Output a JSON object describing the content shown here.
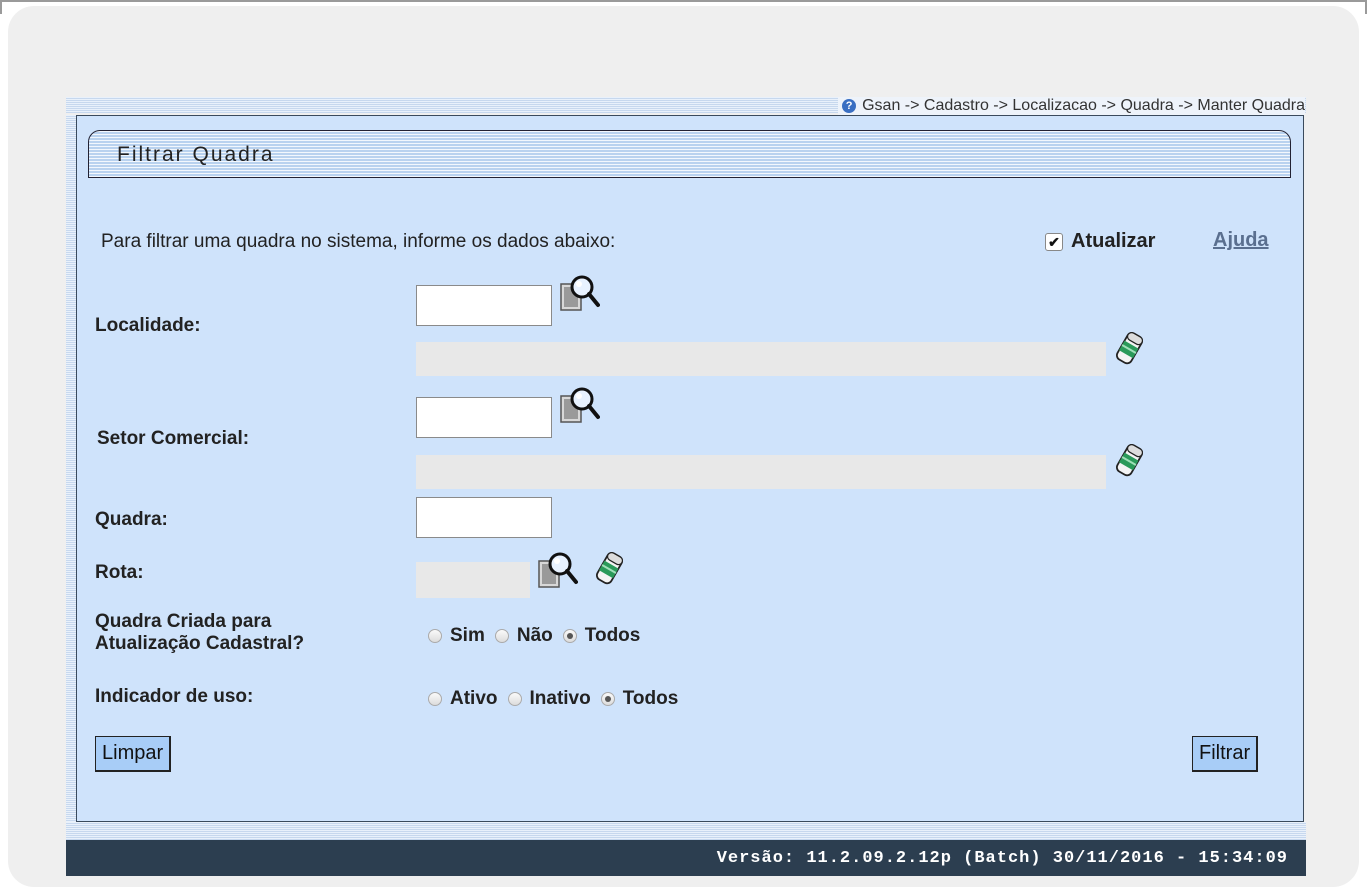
{
  "breadcrumb": "Gsan -> Cadastro -> Localizacao -> Quadra -> Manter Quadra",
  "form": {
    "title": "Filtrar Quadra",
    "intro": "Para filtrar uma quadra no sistema, informe os dados abaixo:",
    "atualizar": {
      "label": "Atualizar",
      "checked": true
    },
    "help_link": "Ajuda",
    "localidade": {
      "label": "Localidade:",
      "code": "",
      "description": ""
    },
    "setor": {
      "label": "Setor Comercial:",
      "code": "",
      "description": ""
    },
    "quadra": {
      "label": "Quadra:",
      "value": ""
    },
    "rota": {
      "label": "Rota:",
      "value": ""
    },
    "atualizacao_cadastral": {
      "label_line1": "Quadra Criada para",
      "label_line2": "Atualização Cadastral?",
      "options": [
        "Sim",
        "Não",
        "Todos"
      ],
      "selected": "Todos"
    },
    "indicador_uso": {
      "label": "Indicador de uso:",
      "options": [
        "Ativo",
        "Inativo",
        "Todos"
      ],
      "selected": "Todos"
    },
    "buttons": {
      "clear": "Limpar",
      "filter": "Filtrar"
    }
  },
  "icons": {
    "search": "search-icon",
    "eraser": "eraser-icon",
    "help": "help-icon"
  },
  "colors": {
    "panel_bg": "#cfe3fb",
    "button_bg": "#a8cdf7",
    "footer_bg": "#2c3e50",
    "help_link": "#5a6f8f"
  },
  "footer": {
    "version": "Versão: 11.2.09.2.12p (Batch) 30/11/2016 - 15:34:09"
  }
}
